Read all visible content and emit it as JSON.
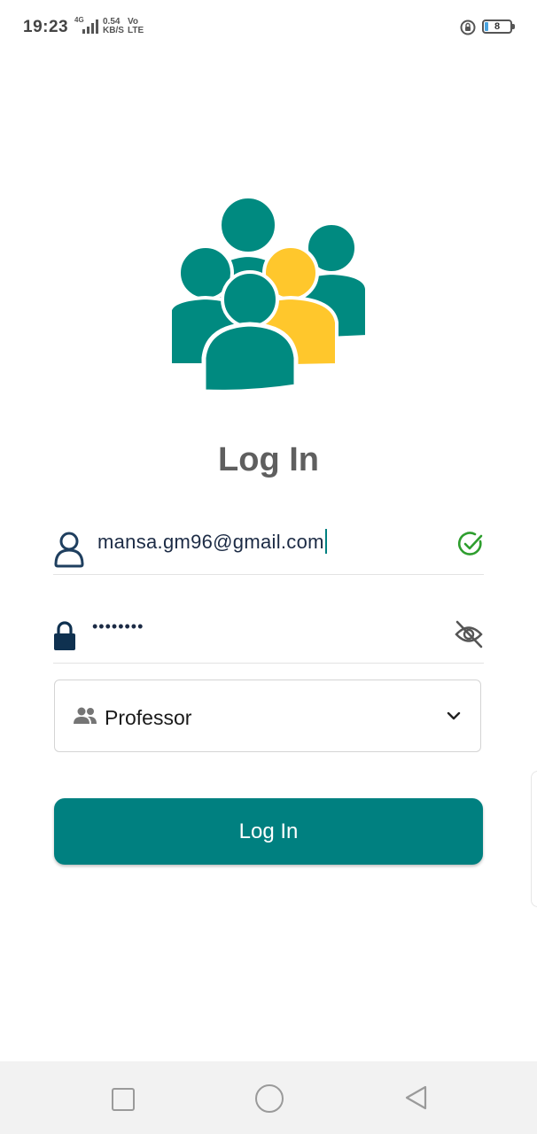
{
  "status_bar": {
    "time": "19:23",
    "network": "4G",
    "speed_value": "0.54",
    "speed_unit": "KB/S",
    "volte_top": "Vo",
    "volte_bottom": "LTE",
    "battery_level": "8"
  },
  "login": {
    "title": "Log In",
    "email_value": "mansa.gm96@gmail.com",
    "password_value": "••••••••",
    "role_selected": "Professor",
    "submit_label": "Log In"
  },
  "colors": {
    "primary": "#008080",
    "accent_yellow": "#FFC72C",
    "valid_green": "#2e9e2e"
  },
  "icons": {
    "email": "user-outline-icon",
    "password": "lock-icon",
    "valid": "check-circle-icon",
    "visibility": "eye-off-icon",
    "role": "people-icon",
    "dropdown": "chevron-down-icon"
  }
}
